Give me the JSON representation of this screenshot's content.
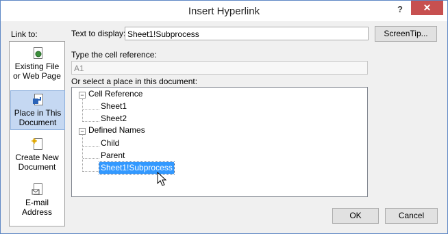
{
  "window": {
    "title": "Insert Hyperlink",
    "help_glyph": "?",
    "close_glyph": "✕"
  },
  "link_to": {
    "heading": "Link to:",
    "items": [
      {
        "line1": "Existing File",
        "line2": "or Web Page",
        "icon": "existing-file-icon",
        "selected": false
      },
      {
        "line1": "Place in This",
        "line2": "Document",
        "icon": "place-in-document-icon",
        "selected": true
      },
      {
        "line1": "Create New",
        "line2": "Document",
        "icon": "create-new-document-icon",
        "selected": false
      },
      {
        "line1": "E-mail",
        "line2": "Address",
        "icon": "email-icon",
        "selected": false
      }
    ]
  },
  "text_to_display": {
    "label": "Text to display:",
    "value": "Sheet1!Subprocess"
  },
  "screentip_button": "ScreenTip...",
  "cell_reference": {
    "label": "Type the cell reference:",
    "value": "A1"
  },
  "place_list": {
    "label": "Or select a place in this document:",
    "groups": [
      {
        "label": "Cell Reference",
        "expanded": true,
        "children": [
          "Sheet1",
          "Sheet2"
        ]
      },
      {
        "label": "Defined Names",
        "expanded": true,
        "children": [
          "Child",
          "Parent",
          "Sheet1!Subprocess"
        ]
      }
    ],
    "selected_item": "Sheet1!Subprocess"
  },
  "buttons": {
    "ok": "OK",
    "cancel": "Cancel"
  },
  "colors": {
    "selection": "#3399ff",
    "close_button": "#c75050",
    "border": "#5c86c4"
  }
}
